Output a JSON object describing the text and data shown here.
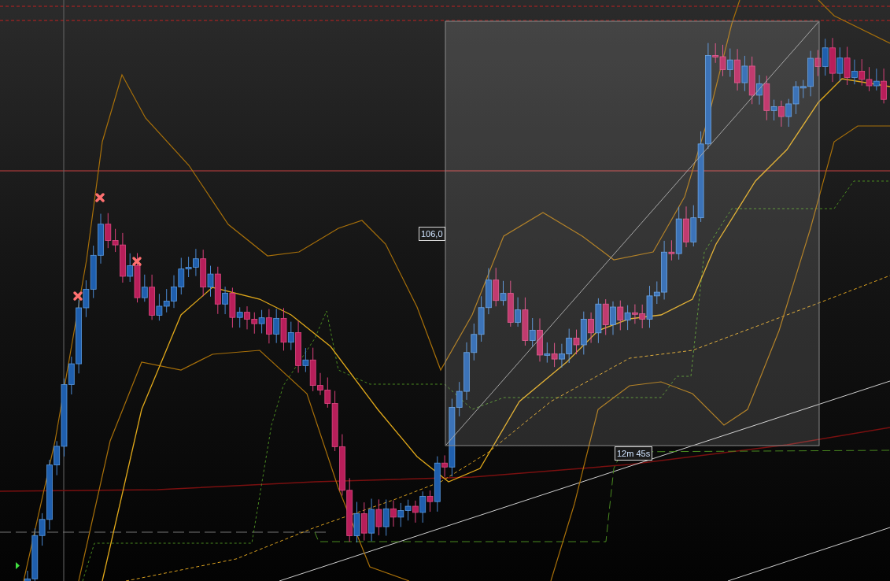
{
  "measure_box": {
    "price_label": "106,0",
    "duration_label": "12m 45s"
  }
}
